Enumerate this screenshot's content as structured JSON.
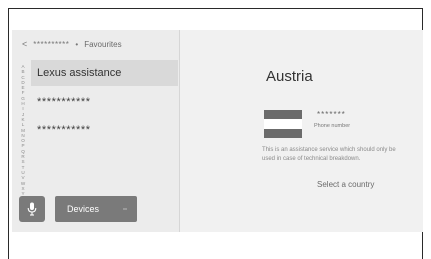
{
  "header": {
    "back_glyph": "<",
    "breadcrumb_masked": "**********",
    "separator": "•",
    "title": "Favourites"
  },
  "alpha_index": [
    "A",
    "B",
    "C",
    "D",
    "E",
    "F",
    "G",
    "H",
    "I",
    "J",
    "K",
    "L",
    "M",
    "N",
    "O",
    "P",
    "Q",
    "R",
    "S",
    "T",
    "U",
    "V",
    "W",
    "X",
    "Y",
    "Z",
    "#"
  ],
  "list": {
    "items": [
      {
        "label": "Lexus assistance",
        "selected": true
      },
      {
        "label": "***********",
        "selected": false
      },
      {
        "label": "***********",
        "selected": false
      }
    ]
  },
  "bottom_bar": {
    "mic_icon": "microphone-icon",
    "devices_label": "Devices"
  },
  "detail": {
    "country": "Austria",
    "phone_masked": "*******",
    "phone_label": "Phone number",
    "info": "This is an assistance service which should only be used in case of technical breakdown.",
    "select_country": "Select a country"
  },
  "colors": {
    "left_bg": "#ececec",
    "right_bg": "#f1f1f1",
    "selected_bg": "#d9d9d9",
    "button_bg": "#7a7a7a",
    "flag_dark": "#6b6b6b",
    "flag_light": "#ffffff"
  }
}
